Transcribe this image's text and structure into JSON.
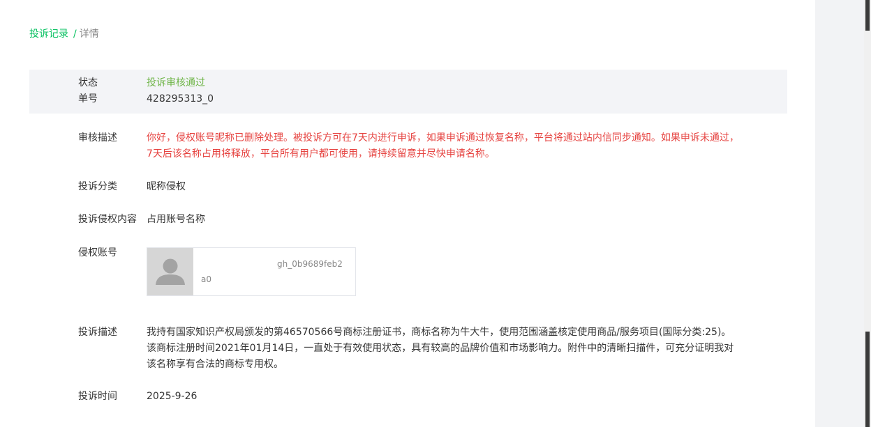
{
  "breadcrumb": {
    "link": "投诉记录",
    "separator": "/",
    "current": "详情"
  },
  "status_panel": {
    "status_label": "状态",
    "status_value": "投诉审核通过",
    "order_label": "单号",
    "order_value": "428295313_0"
  },
  "details": {
    "review_label": "审核描述",
    "review_text": "你好，侵权账号昵称已删除处理。被投诉方可在7天内进行申诉，如果申诉通过恢复名称，平台将通过站内信同步通知。如果申诉未通过，7天后该名称占用将释放，平台所有用户都可使用，请持续留意并尽快申请名称。",
    "category_label": "投诉分类",
    "category_value": "昵称侵权",
    "content_label": "投诉侵权内容",
    "content_value": "占用账号名称",
    "account_label": "侵权账号",
    "account_name": "gh_0b9689feb2a0",
    "description_label": "投诉描述",
    "description_text": "我持有国家知识产权局颁发的第46570566号商标注册证书，商标名称为牛大牛，使用范围涵盖核定使用商品/服务项目(国际分类:25)。该商标注册时间2021年01月14日，一直处于有效使用状态，具有较高的品牌价值和市场影响力。附件中的清晰扫描件，可充分证明我对该名称享有合法的商标专用权。",
    "time_label": "投诉时间",
    "time_value": "2025-9-26"
  },
  "colors": {
    "accent_green": "#07c160",
    "status_ok": "#6fb548",
    "warning_red": "#e64340",
    "panel_bg": "#f3f4f7"
  },
  "icons": {
    "avatar": "default-user-avatar-icon"
  }
}
